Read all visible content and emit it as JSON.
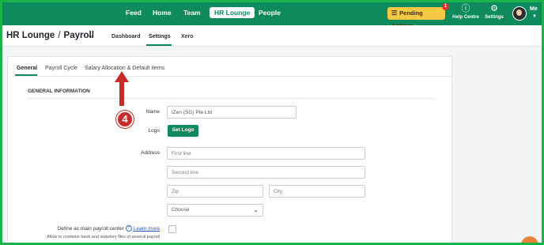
{
  "nav": {
    "items": [
      {
        "label": "Feed",
        "active": false
      },
      {
        "label": "Home",
        "active": false
      },
      {
        "label": "Team",
        "active": false
      },
      {
        "label": "HR Lounge",
        "active": true
      },
      {
        "label": "People",
        "active": false
      }
    ],
    "pending_actions": "Pending Actions",
    "pending_badge": "1",
    "help_label": "Help Centre",
    "settings_label": "Settings",
    "me_label": "Me",
    "brand_color": "#0f8a5c",
    "pending_color": "#f6c945"
  },
  "header": {
    "section": "HR Lounge",
    "separator": "/",
    "page": "Payroll",
    "tabs": [
      {
        "label": "Dashboard",
        "active": false
      },
      {
        "label": "Settings",
        "active": true
      },
      {
        "label": "Xero",
        "active": false
      }
    ]
  },
  "settings": {
    "tabs": [
      {
        "label": "General",
        "active": true
      },
      {
        "label": "Payroll Cycle",
        "active": false
      },
      {
        "label": "Salary Allocation & Default items",
        "active": false
      }
    ],
    "section_title": "GENERAL INFORMATION",
    "name_label": "Name",
    "name_value": "IZen (SG) Pte Ltd",
    "logo_label": "Logo",
    "set_logo_button": "Set Logo",
    "address_label": "Address",
    "address": {
      "line1_placeholder": "First line",
      "line2_placeholder": "Second line",
      "zip_placeholder": "Zip",
      "city_placeholder": "City",
      "country_selected": "Choose"
    },
    "main_center_label": "Define as main payroll center",
    "learn_more": "Learn more",
    "helper_text": "Allow to combine bank and statutory files of several payroll"
  },
  "annotation": {
    "number": "4",
    "color": "#c92a2a"
  }
}
